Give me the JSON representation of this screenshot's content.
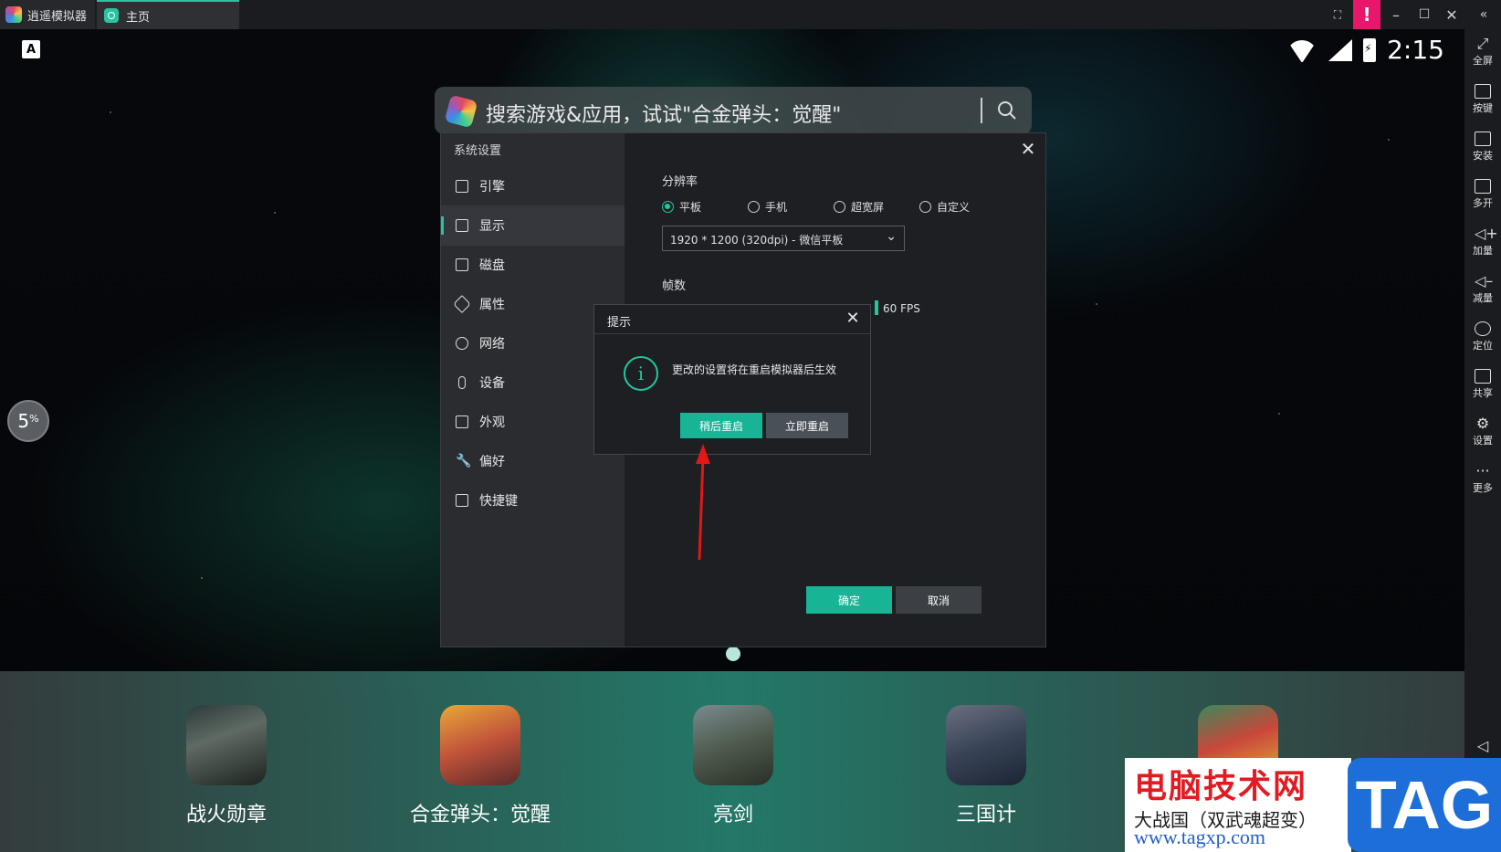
{
  "titlebar": {
    "app_name": "逍遥模拟器",
    "tab_label": "主页",
    "controls": [
      "screenshot-icon",
      "alert-icon",
      "minimize-icon",
      "maximize-icon",
      "close-icon",
      "collapse-icon"
    ],
    "alert_symbol": "!",
    "accent": "#22c7a0",
    "alert_color": "#e8176c"
  },
  "statusbar": {
    "notification_badge": "A",
    "time": "2:15"
  },
  "search": {
    "placeholder": "搜索游戏&应用，试试\"合金弹头：觉醒\""
  },
  "progress_bubble": {
    "value": "5",
    "unit": "%"
  },
  "sidebar": {
    "items": [
      {
        "label": "全屏",
        "icon": "fullscreen-icon"
      },
      {
        "label": "按键",
        "icon": "keyboard-icon"
      },
      {
        "label": "安装",
        "icon": "apk-icon"
      },
      {
        "label": "多开",
        "icon": "multi-instance-icon"
      },
      {
        "label": "加量",
        "icon": "volume-up-icon"
      },
      {
        "label": "减量",
        "icon": "volume-down-icon"
      },
      {
        "label": "定位",
        "icon": "location-icon"
      },
      {
        "label": "共享",
        "icon": "folder-icon"
      },
      {
        "label": "设置",
        "icon": "gear-icon"
      },
      {
        "label": "更多",
        "icon": "more-icon"
      }
    ]
  },
  "settings": {
    "title": "系统设置",
    "nav": [
      {
        "label": "引擎",
        "icon": "engine-icon"
      },
      {
        "label": "显示",
        "icon": "monitor-icon",
        "active": true
      },
      {
        "label": "磁盘",
        "icon": "disk-icon"
      },
      {
        "label": "属性",
        "icon": "tag-icon"
      },
      {
        "label": "网络",
        "icon": "globe-icon"
      },
      {
        "label": "设备",
        "icon": "microphone-icon"
      },
      {
        "label": "外观",
        "icon": "window-icon"
      },
      {
        "label": "偏好",
        "icon": "wrench-icon"
      },
      {
        "label": "快捷键",
        "icon": "keyboard-icon"
      }
    ],
    "resolution_label": "分辨率",
    "resolution_options": [
      {
        "label": "平板",
        "checked": true
      },
      {
        "label": "手机",
        "checked": false
      },
      {
        "label": "超宽屏",
        "checked": false
      },
      {
        "label": "自定义",
        "checked": false
      }
    ],
    "resolution_value": "1920 * 1200 (320dpi) - 微信平板",
    "fps_label": "帧数",
    "fps_value": "60 FPS",
    "ok_label": "确定",
    "cancel_label": "取消"
  },
  "prompt": {
    "title": "提示",
    "message": "更改的设置将在重启模拟器后生效",
    "later_label": "稍后重启",
    "now_label": "立即重启"
  },
  "dock": {
    "apps": [
      {
        "label": "战火勋章"
      },
      {
        "label": "合金弹头：觉醒"
      },
      {
        "label": "亮剑"
      },
      {
        "label": "三国计"
      },
      {
        "label": "大战国（双武魂超变）"
      }
    ]
  },
  "watermark": {
    "site_name": "电脑技术网",
    "url": "www.tagxp.com",
    "tag": "TAG"
  }
}
